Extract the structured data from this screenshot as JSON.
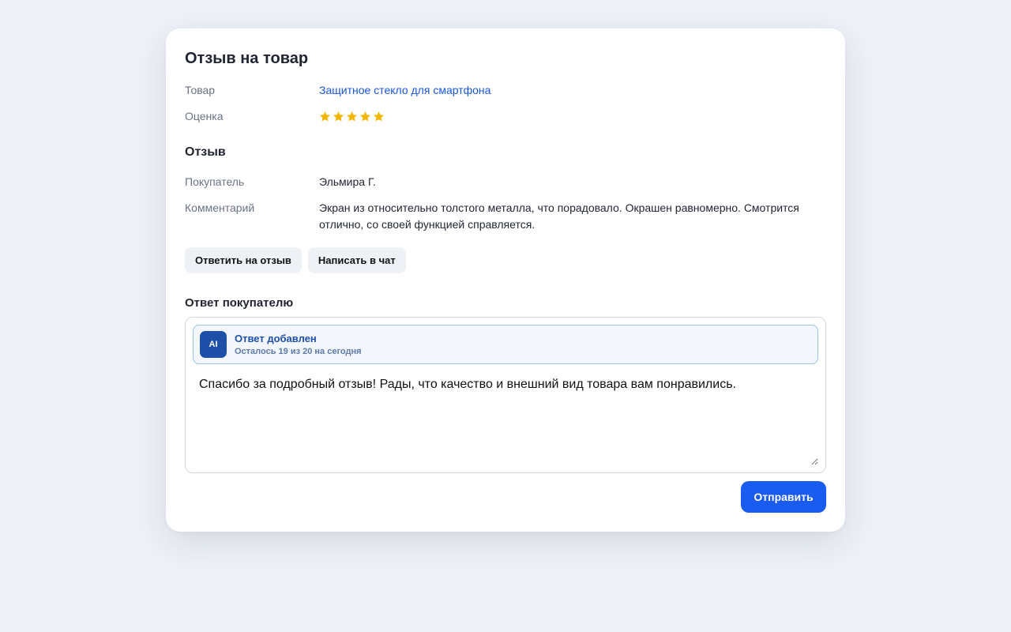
{
  "page": {
    "title": "Отзыв на товар"
  },
  "product": {
    "label": "Товар",
    "name": "Защитное стекло для смартфона"
  },
  "rating": {
    "label": "Оценка",
    "value": 5,
    "max": 5,
    "star_color": "#f2b705"
  },
  "review": {
    "section_title": "Отзыв",
    "buyer_label": "Покупатель",
    "buyer_name": "Эльмира Г.",
    "comment_label": "Комментарий",
    "comment_text": "Экран из относительно толстого металла, что порадовало. Окрашен равномерно. Смотрится отлично, со своей функцией справляется."
  },
  "actions": {
    "reply_label": "Ответить на отзыв",
    "chat_label": "Написать в чат"
  },
  "reply": {
    "section_title": "Ответ покупателю",
    "ai_badge": "AI",
    "ai_status": "Ответ добавлен",
    "ai_quota": "Осталось 19 из 20 на сегодня",
    "text": "Спасибо за подробный отзыв! Рады, что качество и внешний вид товара вам понравились.",
    "send_label": "Отправить"
  },
  "colors": {
    "accent": "#1a5cf0",
    "link": "#1a56db",
    "ai_badge_bg": "#1d4fa8",
    "ai_banner_border": "#9ec0e6",
    "background": "#eef2f7"
  },
  "icons": {
    "star": "star-icon",
    "resize": "resize-handle-icon"
  }
}
